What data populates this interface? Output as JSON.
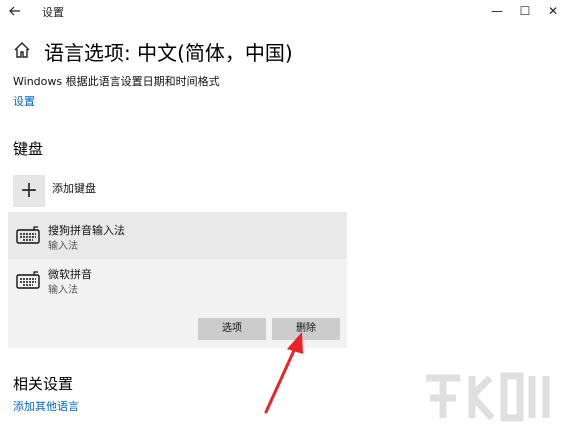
{
  "titlebar": {
    "back_icon": "back-arrow-icon",
    "title": "设置",
    "minimize": "—",
    "maximize": "☐",
    "close": "✕"
  },
  "header": {
    "home_icon": "home-icon",
    "title": "语言选项: 中文(简体，中国)"
  },
  "region": {
    "description": "Windows 根据此语言设置日期和时间格式",
    "settings_link": "设置"
  },
  "keyboard": {
    "section_title": "键盘",
    "add_label": "添加键盘",
    "add_icon_glyph": "+",
    "items": [
      {
        "name": "搜狗拼音输入法",
        "type": "输入法",
        "selected": true
      },
      {
        "name": "微软拼音",
        "type": "输入法",
        "selected": false
      }
    ],
    "options_button": "选项",
    "delete_button": "删除"
  },
  "related": {
    "section_title": "相关设置",
    "add_language_link": "添加其他语言"
  },
  "colors": {
    "link": "#0067c0",
    "arrow": "#e8242b",
    "panel_bg": "#f2f2f2",
    "selected_row_bg": "#e9e9e9",
    "button_bg": "#cccccc"
  }
}
